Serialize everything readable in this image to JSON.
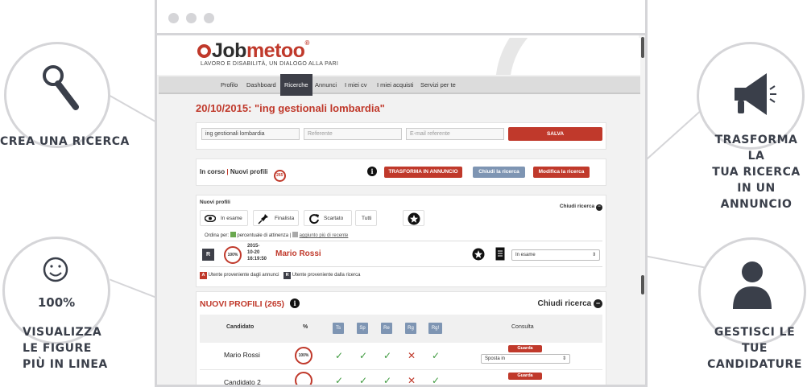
{
  "callouts": {
    "left_top": "CREA UNA RICERCA",
    "left_bottom": [
      "VISUALIZZA",
      "LE FIGURE",
      "PIÙ IN LINEA"
    ],
    "left_bottom_percent": "100%",
    "right_top": [
      "TRASFORMA LA",
      "TUA RICERCA",
      "IN UN ANNUNCIO"
    ],
    "right_bottom": [
      "GESTISCI LE TUE",
      "CANDIDATURE"
    ]
  },
  "brand": {
    "logo_prefix": "Job",
    "logo_suffix": "metoo",
    "registered": "®",
    "tagline": "LAVORO E DISABILITÀ, UN DIALOGO ALLA PARI"
  },
  "nav": [
    "Profilo",
    "Dashboard",
    "Ricerche",
    "Annunci",
    "I miei cv",
    "I miei acquisti",
    "Servizi per te"
  ],
  "nav_active": "Ricerche",
  "search": {
    "title": "20/10/2015: \"ing gestionali lombardia\"",
    "query_value": "ing gestionali lombardia",
    "referente_placeholder": "Referente",
    "email_placeholder": "E-mail referente",
    "save_label": "SALVA"
  },
  "status": {
    "in_corso": "In corso",
    "sep": "|",
    "nuovi_profili": "Nuovi profili",
    "count_badge": "265",
    "info_icon": "i",
    "transform_label": "TRASFORMA IN ANNUNCIO",
    "close_label": "Chiudi la ricerca",
    "edit_label": "Modifica la ricerca"
  },
  "profiles_panel": {
    "heading": "Nuovi profili",
    "close_link": "Chiudi ricerca",
    "tabs": [
      "In esame",
      "Finalista",
      "Scartato",
      "Tutti"
    ],
    "order_label": "Ordina per:",
    "order_opt1": "percentuale di attinenza",
    "order_sep": "|",
    "order_opt2": "aggiunto più di recente",
    "row": {
      "badge": "R",
      "percent": "100%",
      "date_lines": [
        "2015-",
        "10-20",
        "16:19:50"
      ],
      "name": "Mario Rossi",
      "status_select": "In esame"
    },
    "legend_a_badge": "A",
    "legend_a": "Utente proveniente dagli annunci",
    "legend_r_badge": "R",
    "legend_r": "Utente proveniente dalla ricerca"
  },
  "table_panel": {
    "heading": "NUOVI PROFILI (265)",
    "info_icon": "i",
    "close_link": "Chiudi ricerca",
    "columns": [
      "Candidato",
      "%",
      "Ts",
      "Sp",
      "Re",
      "Rg",
      "Rg!",
      "Consulta"
    ],
    "rows": [
      {
        "name": "Mario Rossi",
        "percent": "100%",
        "marks": [
          "check",
          "check",
          "check",
          "cross",
          "check"
        ],
        "view": "Guarda",
        "action": "Sposta in"
      },
      {
        "name": "Candidato 2",
        "percent": "",
        "marks": [
          "check",
          "check",
          "check",
          "cross",
          "check"
        ],
        "view": "Guarda",
        "action": ""
      }
    ]
  },
  "colors": {
    "accent": "#c0392b",
    "blue": "#7e95b3",
    "dark": "#3d3f48",
    "callout": "#3a3f4a"
  }
}
